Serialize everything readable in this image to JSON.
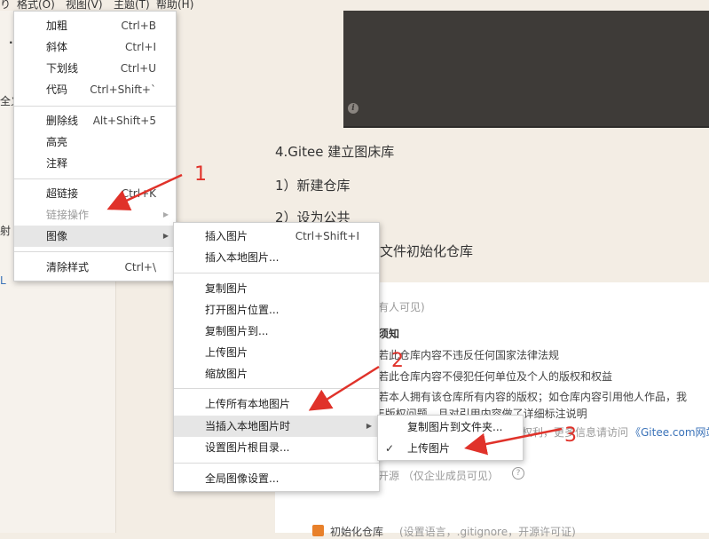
{
  "menubar": {
    "frag": "り",
    "format": "格式(O)",
    "view": "视图(V)",
    "theme": "主题(T)",
    "help": "帮助(H)"
  },
  "left_fragments": [
    ".",
    "全义",
    "射",
    "L"
  ],
  "document": {
    "heading": "4.Gitee 建立图床库",
    "step1": "1）新建仓库",
    "step2": "2）设为公共",
    "step3": "文件初始化仓库"
  },
  "gitee": {
    "visible_all": "有人可见)",
    "notice": "须知",
    "rule1": "若此仓库内容不违反任何国家法律法规",
    "rule2": "若此仓库内容不侵犯任何单位及个人的版权和权益",
    "rule3": "若本人拥有该仓库所有内容的版权；如仓库内容引用他人作品，我",
    "rule4": "E版权问题，且对引用内容做了详细标注说明",
    "more_info": "权利，更多信息请访问",
    "gitee_link": "《Gitee.com网站使",
    "open_source": "开源 （仅企业成员可见）",
    "help_icon": "?",
    "init_repo": "初始化仓库",
    "init_desc": "(设置语言，.gitignore，开源许可证)"
  },
  "format_menu": {
    "items": [
      {
        "label": "加粗",
        "shortcut": "Ctrl+B"
      },
      {
        "label": "斜体",
        "shortcut": "Ctrl+I"
      },
      {
        "label": "下划线",
        "shortcut": "Ctrl+U"
      },
      {
        "label": "代码",
        "shortcut": "Ctrl+Shift+`"
      },
      {
        "label": "删除线",
        "shortcut": "Alt+Shift+5"
      },
      {
        "label": "高亮",
        "shortcut": ""
      },
      {
        "label": "注释",
        "shortcut": ""
      },
      {
        "label": "超链接",
        "shortcut": "Ctrl+K"
      },
      {
        "label": "链接操作",
        "shortcut": ""
      },
      {
        "label": "图像",
        "shortcut": ""
      },
      {
        "label": "清除样式",
        "shortcut": "Ctrl+\\"
      }
    ]
  },
  "image_menu": {
    "items": [
      {
        "label": "插入图片",
        "shortcut": "Ctrl+Shift+I"
      },
      {
        "label": "插入本地图片...",
        "shortcut": ""
      },
      {
        "label": "复制图片",
        "shortcut": ""
      },
      {
        "label": "打开图片位置...",
        "shortcut": ""
      },
      {
        "label": "复制图片到...",
        "shortcut": ""
      },
      {
        "label": "上传图片",
        "shortcut": ""
      },
      {
        "label": "缩放图片",
        "shortcut": ""
      },
      {
        "label": "上传所有本地图片",
        "shortcut": ""
      },
      {
        "label": "当插入本地图片时",
        "shortcut": ""
      },
      {
        "label": "设置图片根目录...",
        "shortcut": ""
      },
      {
        "label": "全局图像设置...",
        "shortcut": ""
      }
    ]
  },
  "insert_menu": {
    "items": [
      {
        "label": "复制图片到文件夹..."
      },
      {
        "label": "上传图片",
        "check": "✓"
      }
    ]
  },
  "annotations": [
    "1",
    "2",
    "3"
  ],
  "colors": {
    "annotation": "#e0322a",
    "hover": "#e6e6e6",
    "checkbox": "#e8802a"
  }
}
